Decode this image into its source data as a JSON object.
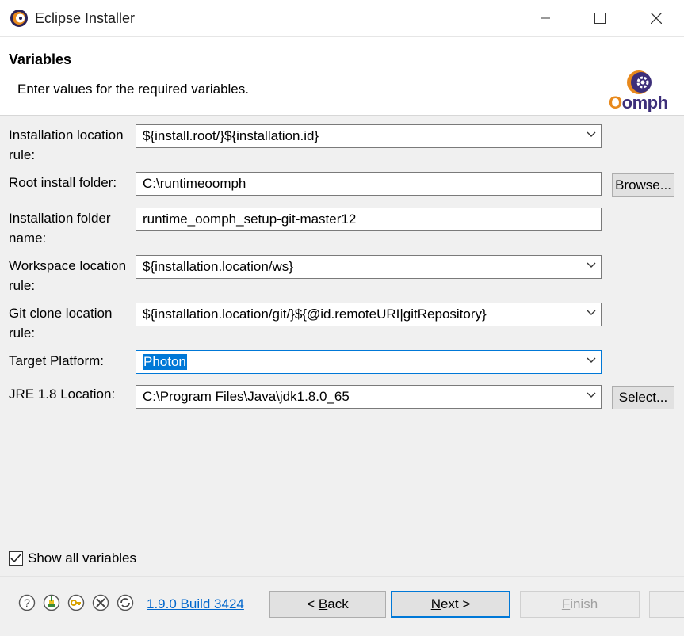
{
  "window": {
    "title": "Eclipse Installer"
  },
  "header": {
    "title": "Variables",
    "description": "Enter values for the required variables.",
    "logo_text": "Oomph"
  },
  "fields": [
    {
      "label": "Installation location rule:",
      "value": "${install.root/}${installation.id}",
      "type": "combo"
    },
    {
      "label": "Root install folder:",
      "value": "C:\\runtimeoomph",
      "type": "text",
      "button": "Browse..."
    },
    {
      "label": "Installation folder name:",
      "value": "runtime_oomph_setup-git-master12",
      "type": "text"
    },
    {
      "label": "Workspace location rule:",
      "value": "${installation.location/ws}",
      "type": "combo"
    },
    {
      "label": "Git clone location rule:",
      "value": "${installation.location/git/}${@id.remoteURI|gitRepository}",
      "type": "combo"
    },
    {
      "label": "Target Platform:",
      "value": "Photon",
      "type": "combo",
      "selected": true
    },
    {
      "label": "JRE 1.8 Location:",
      "value": "C:\\Program Files\\Java\\jdk1.8.0_65",
      "type": "combo",
      "button": "Select..."
    }
  ],
  "show_all_variables": {
    "label": "Show all variables",
    "checked": true
  },
  "footer": {
    "version": "1.9.0 Build 3424",
    "back_label_prefix": "< ",
    "back_label_mnemonic": "B",
    "back_label_rest": "ack",
    "next_label_mnemonic": "N",
    "next_label_rest": "ext >",
    "finish_label_mnemonic": "F",
    "finish_label_rest": "inish"
  },
  "icons": {
    "footer": [
      "help-icon",
      "bundle-pool-icon",
      "key-icon",
      "tools-icon",
      "update-icon"
    ]
  },
  "colors": {
    "accent": "#0078d7",
    "link": "#0066cc",
    "logo_orange": "#e8891c",
    "logo_purple": "#3d2f7a"
  }
}
